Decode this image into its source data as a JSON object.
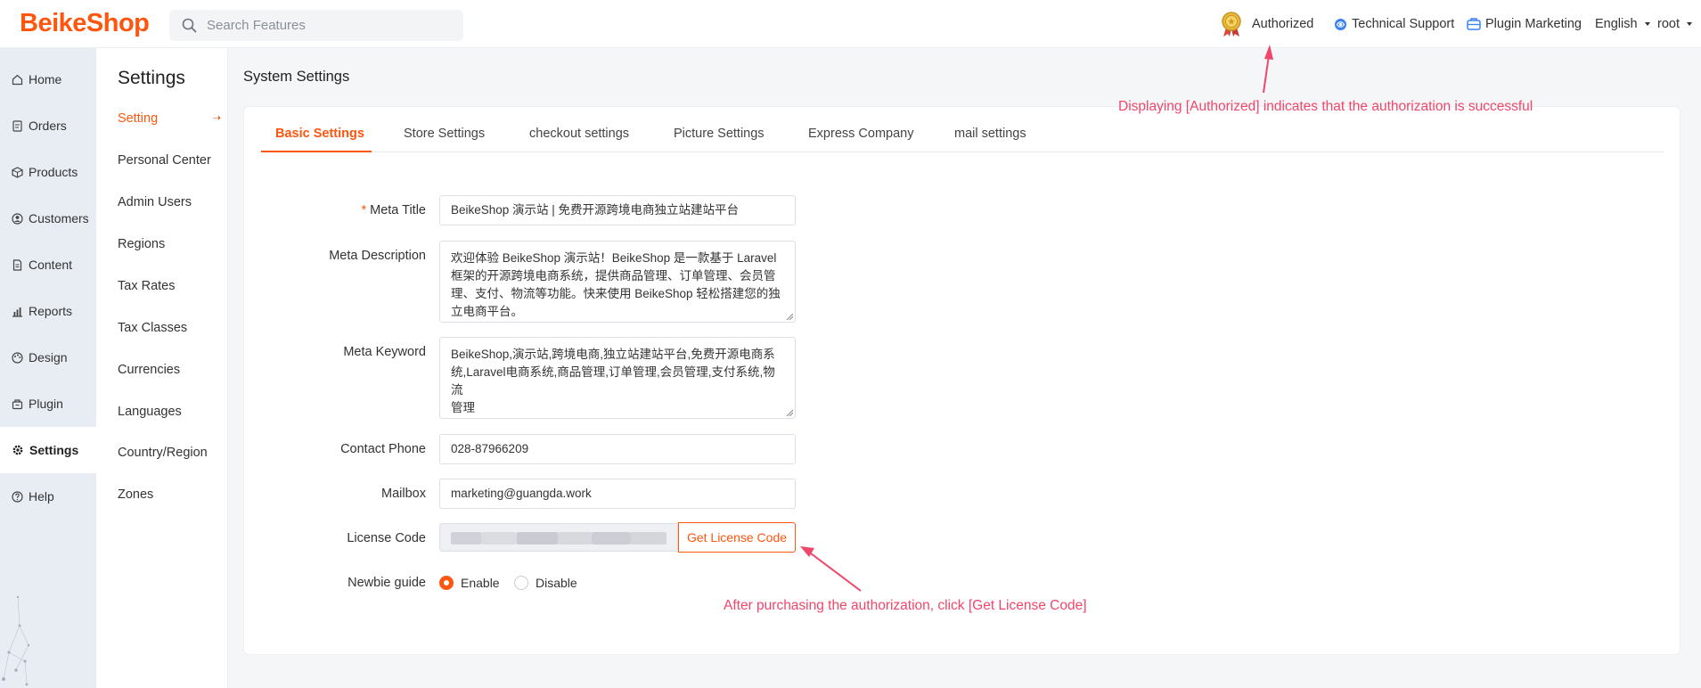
{
  "header": {
    "logo": "BeikeShop",
    "search_placeholder": "Search Features",
    "authorized": "Authorized",
    "technical_support": "Technical Support",
    "plugin_marketing": "Plugin Marketing",
    "language": "English",
    "user": "root"
  },
  "nav": {
    "items": [
      {
        "label": "Home",
        "icon": "home-icon"
      },
      {
        "label": "Orders",
        "icon": "orders-icon"
      },
      {
        "label": "Products",
        "icon": "box-icon"
      },
      {
        "label": "Customers",
        "icon": "user-circle-icon"
      },
      {
        "label": "Content",
        "icon": "document-icon"
      },
      {
        "label": "Reports",
        "icon": "bar-chart-icon"
      },
      {
        "label": "Design",
        "icon": "palette-icon"
      },
      {
        "label": "Plugin",
        "icon": "plugin-icon"
      },
      {
        "label": "Settings",
        "icon": "gear-icon"
      },
      {
        "label": "Help",
        "icon": "help-icon"
      }
    ],
    "active": "Settings"
  },
  "subnav": {
    "title": "Settings",
    "items": [
      "Setting",
      "Personal Center",
      "Admin Users",
      "Regions",
      "Tax Rates",
      "Tax Classes",
      "Currencies",
      "Languages",
      "Country/Region",
      "Zones"
    ],
    "active": "Setting"
  },
  "main": {
    "title": "System Settings",
    "tabs": [
      "Basic Settings",
      "Store Settings",
      "checkout settings",
      "Picture Settings",
      "Express Company",
      "mail settings"
    ],
    "active_tab": "Basic Settings",
    "form": {
      "meta_title_label": "Meta Title",
      "meta_title_value": "BeikeShop 演示站 | 免费开源跨境电商独立站建站平台",
      "meta_description_label": "Meta Description",
      "meta_description_value": "欢迎体验 BeikeShop 演示站！BeikeShop 是一款基于 Laravel 框架的开源跨境电商系统，提供商品管理、订单管理、会员管理、支付、物流等功能。快来使用 BeikeShop 轻松搭建您的独立电商平台。",
      "meta_description_lines": [
        "欢迎体验 BeikeShop 演示站！BeikeShop 是一款基于 Laravel",
        "框架的开源跨境电商系统，提供商品管理、订单管理、会员管",
        "理、支付、物流等功能。快来使用 BeikeShop 轻松搭建您的独",
        "立电商平台。"
      ],
      "meta_keyword_label": "Meta Keyword",
      "meta_keyword_value": "BeikeShop,演示站,跨境电商,独立站建站平台,免费开源电商系统,Laravel电商系统,商品管理,订单管理,会员管理,支付系统,物流管理",
      "meta_keyword_lines": [
        "BeikeShop,演示站,跨境电商,独立站建站平台,免费开源电商系",
        "统,Laravel电商系统,商品管理,订单管理,会员管理,支付系统,物流",
        "管理"
      ],
      "contact_phone_label": "Contact Phone",
      "contact_phone_value": "028-87966209",
      "mailbox_label": "Mailbox",
      "mailbox_value": "marketing@guangda.work",
      "license_code_label": "License Code",
      "get_license_button": "Get License Code",
      "newbie_guide_label": "Newbie guide",
      "newbie_options": [
        "Enable",
        "Disable"
      ],
      "newbie_selected": "Enable"
    }
  },
  "annotations": {
    "authorized_note": "Displaying [Authorized] indicates that the authorization is successful",
    "license_note": "After purchasing the authorization, click [Get License Code]",
    "color": "#f0466a"
  },
  "colors": {
    "accent": "#fd560f",
    "nav_bg": "#e8edf4"
  }
}
